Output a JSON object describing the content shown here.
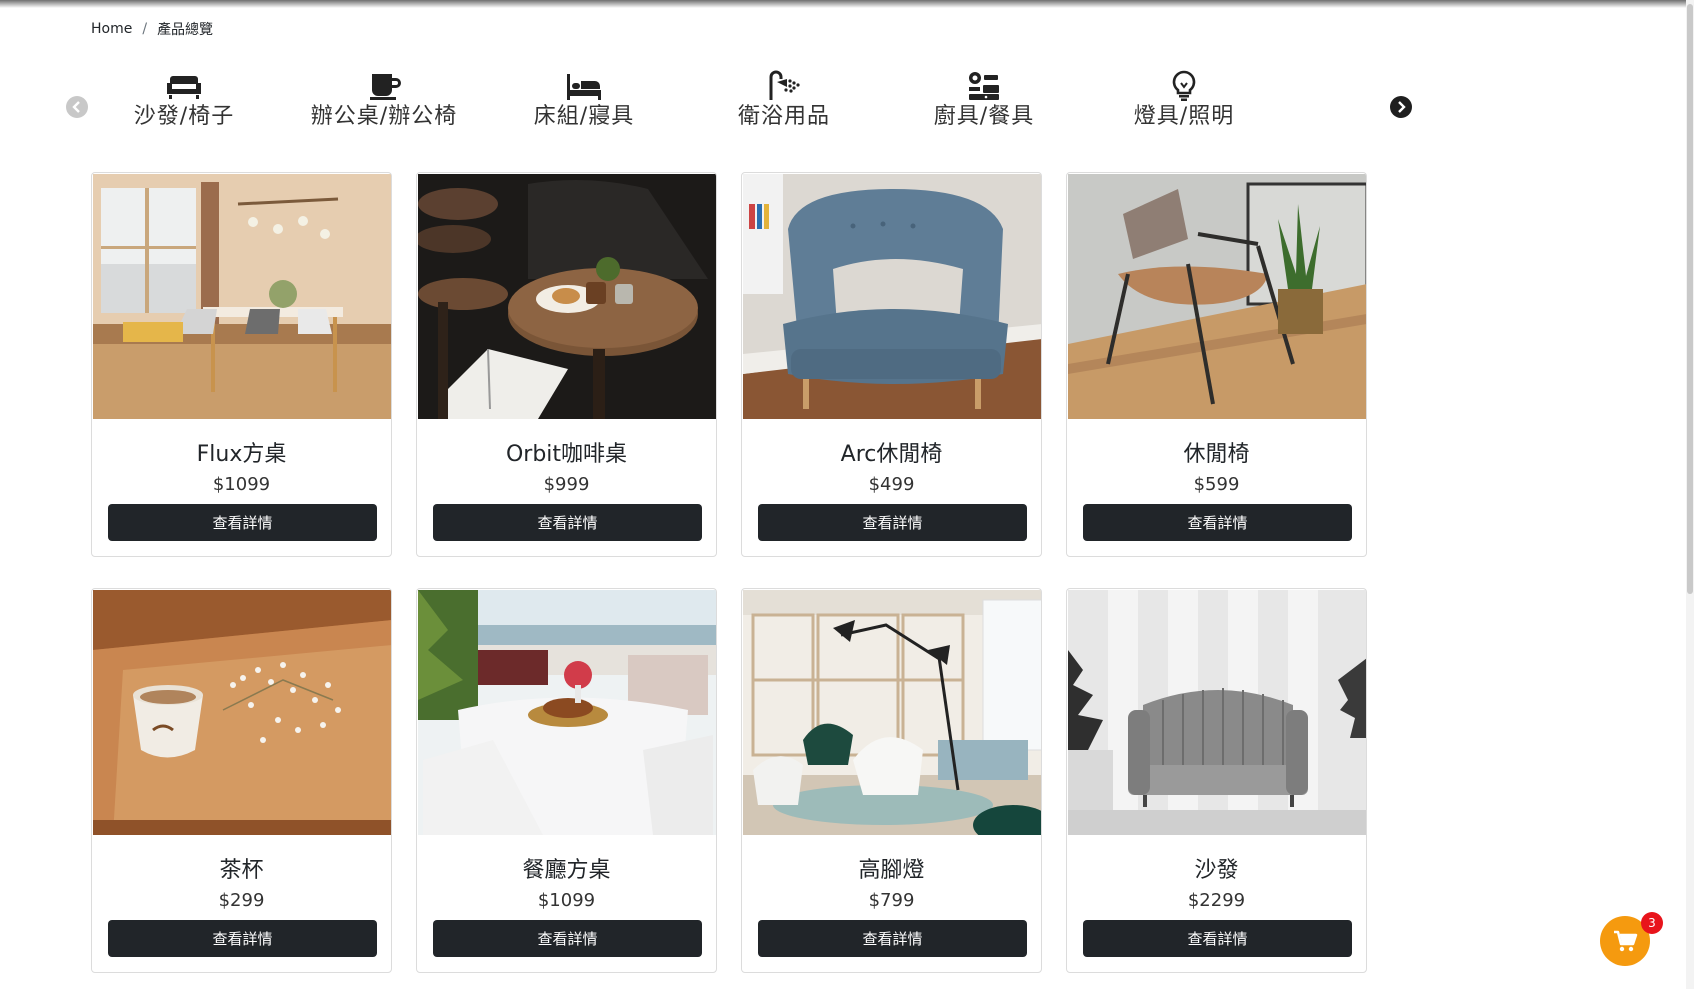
{
  "breadcrumb": {
    "home": "Home",
    "separator": "/",
    "current": "產品總覽"
  },
  "categories": [
    {
      "label": "沙發/椅子",
      "icon": "couch-icon"
    },
    {
      "label": "辦公桌/辦公椅",
      "icon": "mug-icon"
    },
    {
      "label": "床組/寢具",
      "icon": "bed-icon"
    },
    {
      "label": "衛浴用品",
      "icon": "shower-icon"
    },
    {
      "label": "廚具/餐具",
      "icon": "kitchen-icon"
    },
    {
      "label": "燈具/照明",
      "icon": "lightbulb-icon"
    }
  ],
  "products": [
    {
      "title": "Flux方桌",
      "price": "$1099",
      "button": "查看詳情",
      "image": "dining-room-photo"
    },
    {
      "title": "Orbit咖啡桌",
      "price": "$999",
      "button": "查看詳情",
      "image": "coffee-table-photo"
    },
    {
      "title": "Arc休閒椅",
      "price": "$499",
      "button": "查看詳情",
      "image": "blue-armchair-photo"
    },
    {
      "title": "休閒椅",
      "price": "$599",
      "button": "查看詳情",
      "image": "lounge-chair-photo"
    },
    {
      "title": "茶杯",
      "price": "$299",
      "button": "查看詳情",
      "image": "teacup-photo"
    },
    {
      "title": "餐廳方桌",
      "price": "$1099",
      "button": "查看詳情",
      "image": "restaurant-table-photo"
    },
    {
      "title": "高腳燈",
      "price": "$799",
      "button": "查看詳情",
      "image": "floor-lamp-photo"
    },
    {
      "title": "沙發",
      "price": "$2299",
      "button": "查看詳情",
      "image": "grey-sofa-photo"
    }
  ],
  "cart": {
    "count": "3",
    "icon": "cart-icon"
  },
  "colors": {
    "button": "#212529",
    "cart": "#f59a0f",
    "badge": "#e8141b"
  }
}
